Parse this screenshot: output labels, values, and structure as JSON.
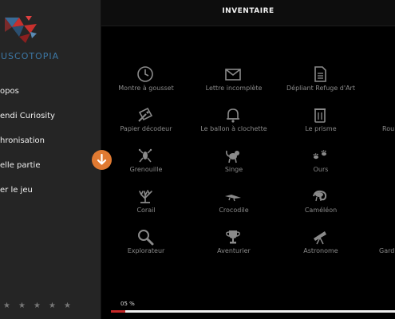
{
  "header": {
    "title": "INVENTAIRE"
  },
  "sidebar": {
    "logo_text": "USCOTOPIA",
    "items": [
      {
        "label": "opos"
      },
      {
        "label": "endi Curiosity"
      },
      {
        "label": "hronisation"
      },
      {
        "label": "elle partie"
      },
      {
        "label": "er le jeu"
      }
    ],
    "stars": [
      "★",
      "★",
      "★",
      "★",
      "★",
      "★"
    ]
  },
  "fab": {
    "icon": "arrow-down-icon"
  },
  "inventory": [
    {
      "label": "Montre à gousset",
      "icon": "clock-icon"
    },
    {
      "label": "Lettre incomplète",
      "icon": "envelope-icon"
    },
    {
      "label": "Dépliant Refuge d'Art",
      "icon": "document-icon"
    },
    {
      "label": "Papier décodeur",
      "icon": "paper-decoder-icon"
    },
    {
      "label": "Le ballon à clochette",
      "icon": "bell-icon"
    },
    {
      "label": "Le prisme",
      "icon": "prism-icon"
    },
    {
      "label": "Rou",
      "icon": ""
    },
    {
      "label": "Grenouille",
      "icon": "frog-icon"
    },
    {
      "label": "Singe",
      "icon": "monkey-icon"
    },
    {
      "label": "Ours",
      "icon": "paw-icon"
    },
    {
      "label": "Corail",
      "icon": "coral-icon"
    },
    {
      "label": "Crocodile",
      "icon": "crocodile-icon"
    },
    {
      "label": "Caméléon",
      "icon": "chameleon-icon"
    },
    {
      "label": "Explorateur",
      "icon": "magnifier-icon"
    },
    {
      "label": "Aventurier",
      "icon": "trophy-icon"
    },
    {
      "label": "Astronome",
      "icon": "telescope-icon"
    },
    {
      "label": "Gard",
      "icon": ""
    }
  ],
  "progress": {
    "label": "05 %",
    "value": 0.05
  },
  "colors": {
    "accent": "#e07a32",
    "progress": "#c62828",
    "logo_blue": "#3d78a6",
    "logo_red": "#c8302d"
  }
}
